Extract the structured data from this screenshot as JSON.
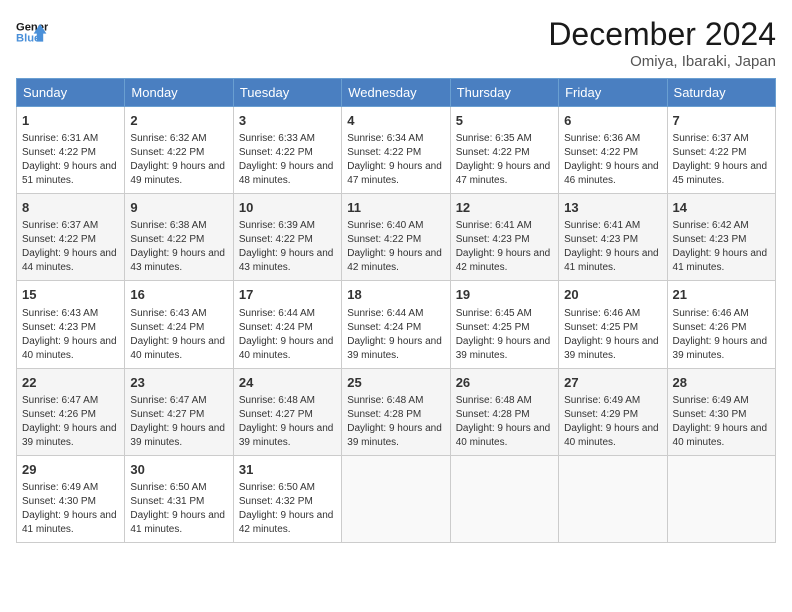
{
  "header": {
    "logo_line1": "General",
    "logo_line2": "Blue",
    "title": "December 2024",
    "subtitle": "Omiya, Ibaraki, Japan"
  },
  "weekdays": [
    "Sunday",
    "Monday",
    "Tuesday",
    "Wednesday",
    "Thursday",
    "Friday",
    "Saturday"
  ],
  "weeks": [
    [
      {
        "day": "1",
        "sunrise": "6:31 AM",
        "sunset": "4:22 PM",
        "daylight": "9 hours and 51 minutes."
      },
      {
        "day": "2",
        "sunrise": "6:32 AM",
        "sunset": "4:22 PM",
        "daylight": "9 hours and 49 minutes."
      },
      {
        "day": "3",
        "sunrise": "6:33 AM",
        "sunset": "4:22 PM",
        "daylight": "9 hours and 48 minutes."
      },
      {
        "day": "4",
        "sunrise": "6:34 AM",
        "sunset": "4:22 PM",
        "daylight": "9 hours and 47 minutes."
      },
      {
        "day": "5",
        "sunrise": "6:35 AM",
        "sunset": "4:22 PM",
        "daylight": "9 hours and 47 minutes."
      },
      {
        "day": "6",
        "sunrise": "6:36 AM",
        "sunset": "4:22 PM",
        "daylight": "9 hours and 46 minutes."
      },
      {
        "day": "7",
        "sunrise": "6:37 AM",
        "sunset": "4:22 PM",
        "daylight": "9 hours and 45 minutes."
      }
    ],
    [
      {
        "day": "8",
        "sunrise": "6:37 AM",
        "sunset": "4:22 PM",
        "daylight": "9 hours and 44 minutes."
      },
      {
        "day": "9",
        "sunrise": "6:38 AM",
        "sunset": "4:22 PM",
        "daylight": "9 hours and 43 minutes."
      },
      {
        "day": "10",
        "sunrise": "6:39 AM",
        "sunset": "4:22 PM",
        "daylight": "9 hours and 43 minutes."
      },
      {
        "day": "11",
        "sunrise": "6:40 AM",
        "sunset": "4:22 PM",
        "daylight": "9 hours and 42 minutes."
      },
      {
        "day": "12",
        "sunrise": "6:41 AM",
        "sunset": "4:23 PM",
        "daylight": "9 hours and 42 minutes."
      },
      {
        "day": "13",
        "sunrise": "6:41 AM",
        "sunset": "4:23 PM",
        "daylight": "9 hours and 41 minutes."
      },
      {
        "day": "14",
        "sunrise": "6:42 AM",
        "sunset": "4:23 PM",
        "daylight": "9 hours and 41 minutes."
      }
    ],
    [
      {
        "day": "15",
        "sunrise": "6:43 AM",
        "sunset": "4:23 PM",
        "daylight": "9 hours and 40 minutes."
      },
      {
        "day": "16",
        "sunrise": "6:43 AM",
        "sunset": "4:24 PM",
        "daylight": "9 hours and 40 minutes."
      },
      {
        "day": "17",
        "sunrise": "6:44 AM",
        "sunset": "4:24 PM",
        "daylight": "9 hours and 40 minutes."
      },
      {
        "day": "18",
        "sunrise": "6:44 AM",
        "sunset": "4:24 PM",
        "daylight": "9 hours and 39 minutes."
      },
      {
        "day": "19",
        "sunrise": "6:45 AM",
        "sunset": "4:25 PM",
        "daylight": "9 hours and 39 minutes."
      },
      {
        "day": "20",
        "sunrise": "6:46 AM",
        "sunset": "4:25 PM",
        "daylight": "9 hours and 39 minutes."
      },
      {
        "day": "21",
        "sunrise": "6:46 AM",
        "sunset": "4:26 PM",
        "daylight": "9 hours and 39 minutes."
      }
    ],
    [
      {
        "day": "22",
        "sunrise": "6:47 AM",
        "sunset": "4:26 PM",
        "daylight": "9 hours and 39 minutes."
      },
      {
        "day": "23",
        "sunrise": "6:47 AM",
        "sunset": "4:27 PM",
        "daylight": "9 hours and 39 minutes."
      },
      {
        "day": "24",
        "sunrise": "6:48 AM",
        "sunset": "4:27 PM",
        "daylight": "9 hours and 39 minutes."
      },
      {
        "day": "25",
        "sunrise": "6:48 AM",
        "sunset": "4:28 PM",
        "daylight": "9 hours and 39 minutes."
      },
      {
        "day": "26",
        "sunrise": "6:48 AM",
        "sunset": "4:28 PM",
        "daylight": "9 hours and 40 minutes."
      },
      {
        "day": "27",
        "sunrise": "6:49 AM",
        "sunset": "4:29 PM",
        "daylight": "9 hours and 40 minutes."
      },
      {
        "day": "28",
        "sunrise": "6:49 AM",
        "sunset": "4:30 PM",
        "daylight": "9 hours and 40 minutes."
      }
    ],
    [
      {
        "day": "29",
        "sunrise": "6:49 AM",
        "sunset": "4:30 PM",
        "daylight": "9 hours and 41 minutes."
      },
      {
        "day": "30",
        "sunrise": "6:50 AM",
        "sunset": "4:31 PM",
        "daylight": "9 hours and 41 minutes."
      },
      {
        "day": "31",
        "sunrise": "6:50 AM",
        "sunset": "4:32 PM",
        "daylight": "9 hours and 42 minutes."
      },
      null,
      null,
      null,
      null
    ]
  ],
  "labels": {
    "sunrise": "Sunrise:",
    "sunset": "Sunset:",
    "daylight": "Daylight:"
  }
}
